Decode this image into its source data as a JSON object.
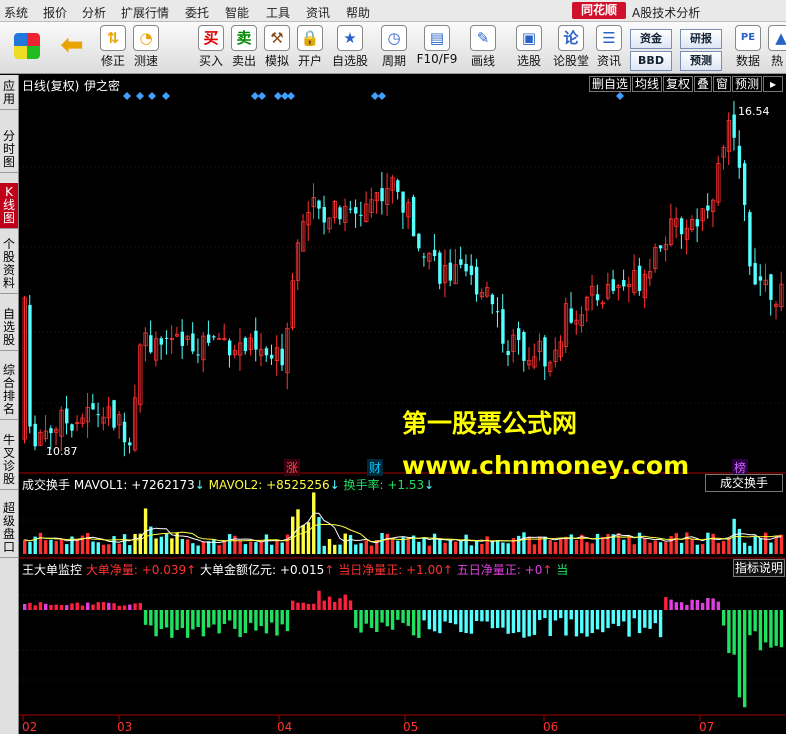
{
  "menu": {
    "items": [
      "系统",
      "报价",
      "分析",
      "扩展行情",
      "委托",
      "智能",
      "工具",
      "资讯",
      "帮助"
    ],
    "logo": "同花顺",
    "app_title": "A股技术分析"
  },
  "toolbar": {
    "buttons": [
      {
        "label": "",
        "icon": "windows-grid-icon"
      },
      {
        "label": "",
        "icon": "back-arrow-icon"
      },
      {
        "label": "修正",
        "icon": "adjust-icon"
      },
      {
        "label": "测速",
        "icon": "clock-icon"
      },
      {
        "label": "买入",
        "icon": "buy-icon",
        "glyph": "买"
      },
      {
        "label": "卖出",
        "icon": "sell-icon",
        "glyph": "卖"
      },
      {
        "label": "模拟",
        "icon": "hammer-icon"
      },
      {
        "label": "开户",
        "icon": "lock-icon"
      },
      {
        "label": "自选股",
        "icon": "star-folder-icon"
      },
      {
        "label": "周期",
        "icon": "period-icon"
      },
      {
        "label": "F10/F9",
        "icon": "f10-icon"
      },
      {
        "label": "画线",
        "icon": "pencil-icon"
      },
      {
        "label": "选股",
        "icon": "screen-icon"
      },
      {
        "label": "论股堂",
        "icon": "forum-icon",
        "glyph": "论"
      },
      {
        "label": "资讯",
        "icon": "news-icon"
      },
      {
        "label": "数据",
        "icon": "pe-icon",
        "glyph": "PE"
      },
      {
        "label": "热",
        "icon": "hot-icon"
      }
    ],
    "small_buttons": [
      "资金",
      "研报",
      "BBD",
      "预测"
    ]
  },
  "side_tabs": [
    {
      "label": "应用"
    },
    {
      "label": "分时图"
    },
    {
      "label": "K线图",
      "active": true
    },
    {
      "label": "个股资料"
    },
    {
      "label": "自选股"
    },
    {
      "label": "综合排名"
    },
    {
      "label": "牛叉诊股"
    },
    {
      "label": "超级盘口"
    }
  ],
  "chart_header": {
    "title": "日线(复权)",
    "name": "伊之密",
    "right_buttons": [
      "删自选",
      "均线",
      "复权",
      "叠",
      "窗",
      "预测"
    ]
  },
  "price_labels": {
    "high": "16.54",
    "low": "10.87"
  },
  "markers": [
    {
      "text": "涨",
      "color": "#ff4040"
    },
    {
      "text": "财",
      "color": "#00c8ff"
    },
    {
      "text": "榜",
      "color": "#cc66ff"
    }
  ],
  "volume_panel": {
    "name": "成交换手",
    "mavol1_label": "MAVOL1:",
    "mavol1_value": "+7262173",
    "mavol2_label": "MAVOL2:",
    "mavol2_value": "+8525256",
    "turnover_label": "换手率:",
    "turnover_value": "+1.53",
    "button": "成交换手"
  },
  "flow_panel": {
    "name": "王大单监控",
    "big_net_label": "大单净量:",
    "big_net_value": "+0.039",
    "big_amt_label": "大单金额亿元:",
    "big_amt_value": "+0.015",
    "day_net_label": "当日净量正:",
    "day_net_value": "+1.00",
    "five_net_label": "五日净量正:",
    "five_net_value": "+0",
    "tail": "当",
    "button": "指标说明"
  },
  "x_axis": {
    "labels": [
      "02",
      "03",
      "04",
      "05",
      "06",
      "07"
    ]
  },
  "watermark": {
    "line1": "第一股票公式网",
    "line2": "www.chnmoney.com"
  },
  "colors": {
    "up": "#ff3232",
    "down": "#54ffff",
    "volume_up": "#ffff40",
    "flow_pos": "#ff2040",
    "flow_neg": "#20e060",
    "flow_pink": "#e040e0"
  },
  "chart_data": {
    "type": "candlestick",
    "series_count": 145,
    "price_range": [
      10.5,
      17.2
    ],
    "high": 16.54,
    "low": 10.87,
    "x_months": [
      "02",
      "03",
      "04",
      "05",
      "06",
      "07"
    ]
  }
}
